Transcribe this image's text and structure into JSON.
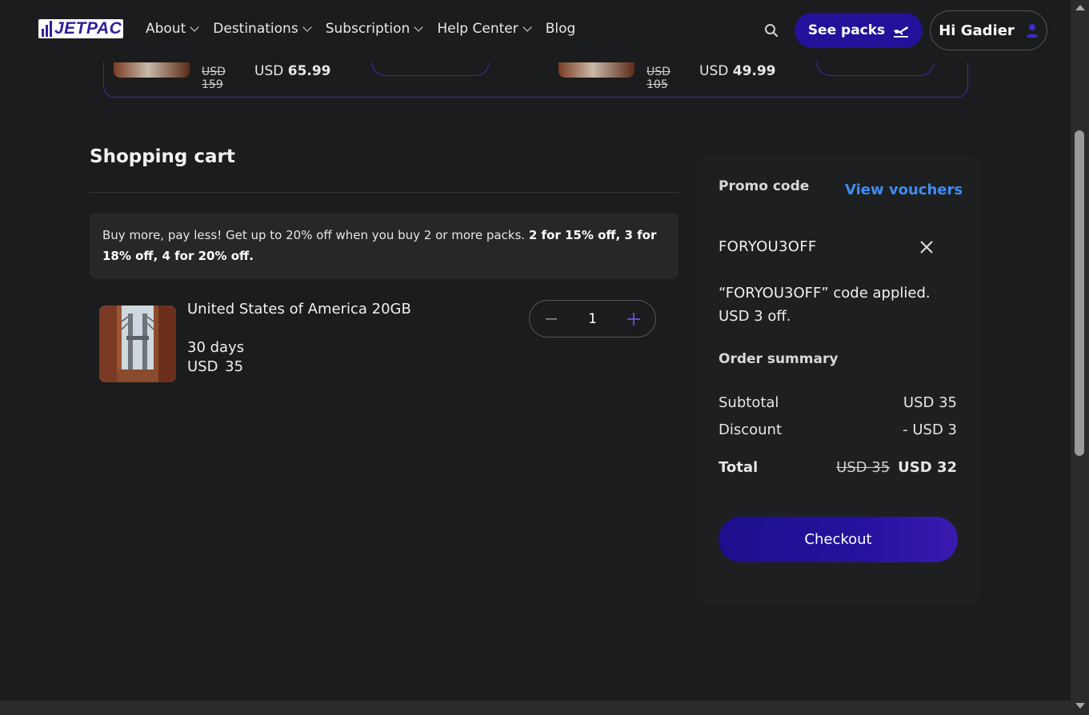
{
  "header": {
    "logo_text": "JETPAC",
    "nav": [
      {
        "label": "About",
        "has_dropdown": true
      },
      {
        "label": "Destinations",
        "has_dropdown": true
      },
      {
        "label": "Subscription",
        "has_dropdown": true
      },
      {
        "label": "Help Center",
        "has_dropdown": true
      },
      {
        "label": "Blog",
        "has_dropdown": false
      }
    ],
    "see_packs_label": "See packs",
    "user_greeting": "Hi Gadier"
  },
  "upgrade_banner": {
    "cards": [
      {
        "old_price": "USD 159",
        "price_prefix": "USD",
        "price_value": "65.99"
      },
      {
        "old_price": "USD 105",
        "price_prefix": "USD",
        "price_value": "49.99"
      }
    ]
  },
  "cart": {
    "title": "Shopping cart",
    "promo_text": "Buy more, pay less! Get up to 20% off when you buy 2 or more packs.",
    "promo_bold": "2 for 15% off, 3 for 18% off, 4 for 20% off.",
    "items": [
      {
        "name": "United States of America 20GB",
        "duration": "30 days",
        "price": "USD 35",
        "quantity": "1"
      }
    ]
  },
  "summary": {
    "promo_label": "Promo code",
    "view_vouchers": "View vouchers",
    "code_value": "FORYOU3OFF",
    "applied_message": "“FORYOU3OFF” code applied. USD 3 off.",
    "order_summary_label": "Order summary",
    "subtotal_label": "Subtotal",
    "subtotal_value": "USD 35",
    "discount_label": "Discount",
    "discount_value": "- USD 3",
    "total_label": "Total",
    "total_old": "USD 35",
    "total_value": "USD 32",
    "checkout_label": "Checkout"
  },
  "colors": {
    "accent": "#23119a",
    "link": "#3f8cf2",
    "background": "#1b1c1d"
  }
}
